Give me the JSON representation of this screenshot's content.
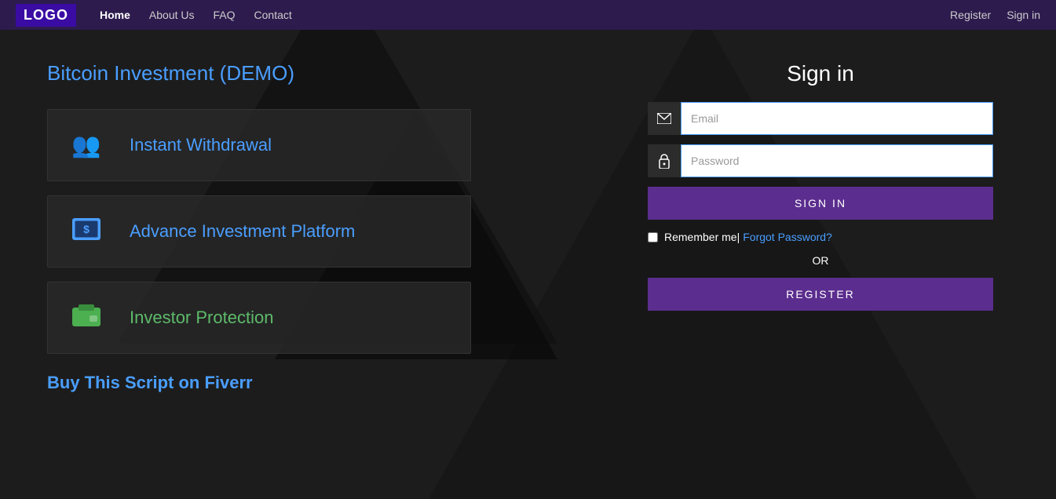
{
  "navbar": {
    "logo": "LOGO",
    "links": [
      {
        "label": "Home",
        "active": true
      },
      {
        "label": "About Us",
        "active": false
      },
      {
        "label": "FAQ",
        "active": false
      },
      {
        "label": "Contact",
        "active": false
      }
    ],
    "right_links": [
      {
        "label": "Register"
      },
      {
        "label": "Sign in"
      }
    ]
  },
  "hero": {
    "title": "Bitcoin Investment (DEMO)"
  },
  "features": [
    {
      "label": "Instant Withdrawal",
      "icon": "users-icon",
      "icon_char": "👥"
    },
    {
      "label": "Advance Investment Platform",
      "icon": "dollar-icon",
      "icon_char": "💵"
    },
    {
      "label": "Investor Protection",
      "icon": "wallet-icon",
      "icon_char": "💳"
    }
  ],
  "buy_section": {
    "text": "Buy This Script on",
    "link": "Fiverr"
  },
  "signin": {
    "title": "Sign in",
    "email_placeholder": "Email",
    "password_placeholder": "Password",
    "signin_button": "SIGN IN",
    "remember_label": "Remember me",
    "forgot_label": "Forgot Password?",
    "or_label": "OR",
    "register_button": "REGISTER"
  }
}
